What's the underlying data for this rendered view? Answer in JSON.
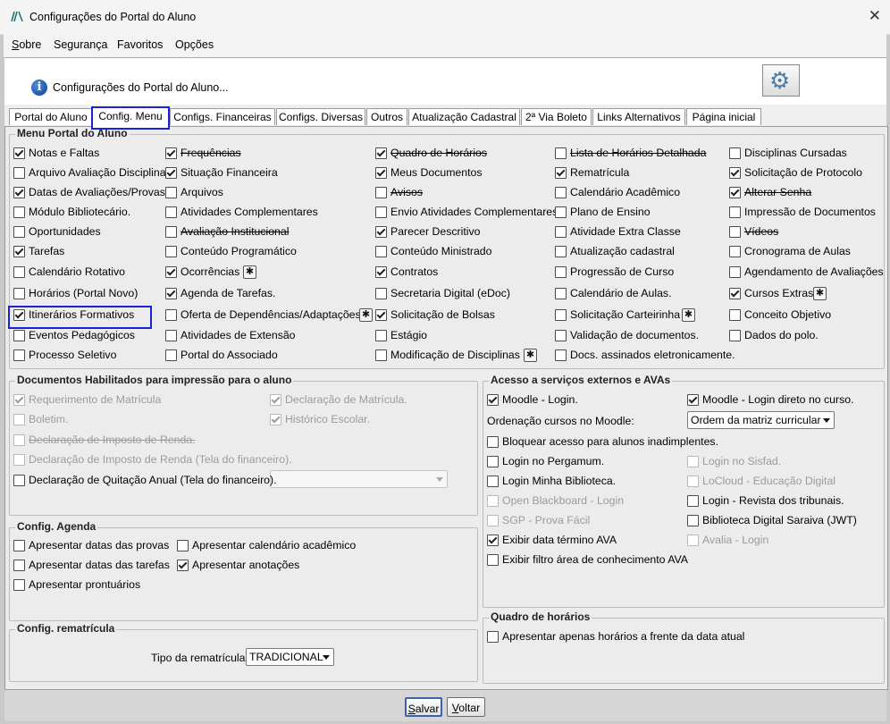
{
  "window": {
    "title": "Configurações do Portal do Aluno",
    "close_glyph": "✕"
  },
  "menu": [
    {
      "first": "S",
      "rest": "obre"
    },
    {
      "first": "",
      "rest": "Segurança"
    },
    {
      "first": "",
      "rest": "Favoritos"
    },
    {
      "first": "",
      "rest": "Opções"
    }
  ],
  "header": {
    "text": "Configurações do Portal do Aluno...",
    "info_glyph": "i",
    "gear_glyph": "⚙"
  },
  "tabs": [
    "Portal do Aluno",
    "Config. Menu",
    "Configs. Financeiras",
    "Configs. Diversas",
    "Outros",
    "Atualização Cadastral",
    "2ª Via Boleto",
    "Links Alternativos",
    "Página inicial"
  ],
  "active_tab": "Config. Menu",
  "menu_portal": {
    "title": "Menu Portal do Aluno",
    "items": [
      {
        "label": "Notas e Faltas",
        "checked": true
      },
      {
        "label": "Frequências",
        "checked": true,
        "strike": true
      },
      {
        "label": "Quadro de Horários",
        "checked": true,
        "strike": true
      },
      {
        "label": "Lista de Horários Detalhada",
        "checked": false,
        "strike": true
      },
      {
        "label": "Disciplinas Cursadas",
        "checked": false
      },
      {
        "label": "Arquivo Avaliação Disciplina",
        "checked": false
      },
      {
        "label": "Situação Financeira",
        "checked": true
      },
      {
        "label": "Meus Documentos",
        "checked": true
      },
      {
        "label": "Rematrícula",
        "checked": true
      },
      {
        "label": "Solicitação de Protocolo",
        "checked": true
      },
      {
        "label": "Datas de Avaliações/Provas",
        "checked": true
      },
      {
        "label": "Arquivos",
        "checked": false
      },
      {
        "label": "Avisos",
        "checked": false,
        "strike": true
      },
      {
        "label": "Calendário Acadêmico",
        "checked": false
      },
      {
        "label": "Alterar Senha",
        "checked": true,
        "strike": true
      },
      {
        "label": "Módulo Bibliotecário.",
        "checked": false
      },
      {
        "label": "Atividades Complementares",
        "checked": false
      },
      {
        "label": "Envio Atividades Complementares",
        "checked": false
      },
      {
        "label": "Plano de Ensino",
        "checked": false
      },
      {
        "label": "Impressão de Documentos",
        "checked": false
      },
      {
        "label": "Oportunidades",
        "checked": false
      },
      {
        "label": "Avaliação Institucional",
        "checked": false,
        "strike": true
      },
      {
        "label": "Parecer Descritivo",
        "checked": true
      },
      {
        "label": "Atividade Extra Classe",
        "checked": false
      },
      {
        "label": "Vídeos",
        "checked": false,
        "strike": true
      },
      {
        "label": "Tarefas",
        "checked": true
      },
      {
        "label": "Conteúdo Programático",
        "checked": false
      },
      {
        "label": "Conteúdo Ministrado",
        "checked": false
      },
      {
        "label": "Atualização cadastral",
        "checked": false
      },
      {
        "label": "Cronograma de Aulas",
        "checked": false
      },
      {
        "label": "Calendário Rotativo",
        "checked": false
      },
      {
        "label": "Ocorrências",
        "checked": true
      },
      {
        "label": "Contratos",
        "checked": true
      },
      {
        "label": "Progressão de Curso",
        "checked": false
      },
      {
        "label": "Agendamento de Avaliações",
        "checked": false
      },
      {
        "label": "Horários (Portal Novo)",
        "checked": false
      },
      {
        "label": "Agenda de Tarefas.",
        "checked": true
      },
      {
        "label": "Secretaria Digital (eDoc)",
        "checked": false
      },
      {
        "label": "Calendário de Aulas.",
        "checked": false
      },
      {
        "label": "Cursos Extras",
        "checked": true
      },
      {
        "label": "Itinerários Formativos",
        "checked": true
      },
      {
        "label": "Oferta de Dependências/Adaptações",
        "checked": false
      },
      {
        "label": "Solicitação de Bolsas",
        "checked": true
      },
      {
        "label": "Solicitação Carteirinha",
        "checked": false
      },
      {
        "label": "Conceito Objetivo",
        "checked": false
      },
      {
        "label": "Eventos Pedagógicos",
        "checked": false
      },
      {
        "label": "Atividades de Extensão",
        "checked": false
      },
      {
        "label": "Estágio",
        "checked": false
      },
      {
        "label": "Validação de documentos.",
        "checked": false
      },
      {
        "label": "Dados do polo.",
        "checked": false
      },
      {
        "label": "Processo Seletivo",
        "checked": false
      },
      {
        "label": "Portal do Associado",
        "checked": false
      },
      {
        "label": "Modificação de Disciplinas",
        "checked": false
      },
      {
        "label": "Docs. assinados eletronicamente.",
        "checked": false
      }
    ]
  },
  "docs": {
    "title": "Documentos Habilitados para impressão para o aluno",
    "items": [
      {
        "label": "Requerimento de Matrícula",
        "checked": true,
        "disabled": true
      },
      {
        "label": "Declaração de Matrícula.",
        "checked": true,
        "disabled": true
      },
      {
        "label": "Boletim.",
        "checked": false,
        "disabled": true
      },
      {
        "label": "Histórico Escolar.",
        "checked": true,
        "disabled": true
      },
      {
        "label": "Declaração de Imposto de Renda.",
        "checked": false,
        "disabled": true,
        "strike": true
      },
      {
        "label": "Declaração de Imposto de Renda (Tela do financeiro).",
        "checked": false,
        "disabled": true
      },
      {
        "label": "Declaração de Quitação Anual (Tela do financeiro).",
        "checked": false
      }
    ],
    "quitacao_select": ""
  },
  "agenda": {
    "title": "Config. Agenda",
    "items": [
      {
        "label": "Apresentar datas das provas",
        "checked": false
      },
      {
        "label": "Apresentar calendário acadêmico",
        "checked": false
      },
      {
        "label": "Apresentar datas das tarefas",
        "checked": false
      },
      {
        "label": "Apresentar anotações",
        "checked": true
      },
      {
        "label": "Apresentar prontuários",
        "checked": false
      }
    ]
  },
  "rematricula": {
    "title": "Config. rematrícula",
    "tipo_label": "Tipo da rematrícula:",
    "tipo_value": "TRADICIONAL"
  },
  "ava": {
    "title": "Acesso a serviços externos e AVAs",
    "ordenacao_label": "Ordenação cursos no Moodle:",
    "ordenacao_value": "Ordem da matriz curricular",
    "items": [
      {
        "label": "Moodle - Login.",
        "checked": true
      },
      {
        "label": "Moodle - Login direto no curso.",
        "checked": true
      },
      {
        "label": "Bloquear acesso para alunos inadimplentes.",
        "checked": false
      },
      {
        "label": "Login no Pergamum.",
        "checked": false
      },
      {
        "label": "Login no Sisfad.",
        "checked": false,
        "disabled": true
      },
      {
        "label": "Login Minha Biblioteca.",
        "checked": false
      },
      {
        "label": "LoCloud - Educação Digital",
        "checked": false,
        "disabled": true
      },
      {
        "label": "Open Blackboard - Login",
        "checked": false,
        "disabled": true
      },
      {
        "label": "Login - Revista dos tribunais.",
        "checked": false
      },
      {
        "label": "SGP - Prova Fácil",
        "checked": false,
        "disabled": true
      },
      {
        "label": "Biblioteca Digital Saraiva (JWT)",
        "checked": false
      },
      {
        "label": "Exibir data término AVA",
        "checked": true
      },
      {
        "label": "Avalia - Login",
        "checked": false,
        "disabled": true
      },
      {
        "label": "Exibir filtro área de conhecimento AVA",
        "checked": false
      }
    ]
  },
  "quadro": {
    "title": "Quadro de horários",
    "items": [
      {
        "label": "Apresentar apenas horários a frente da data atual",
        "checked": false
      }
    ]
  },
  "buttons": {
    "salvar_first": "S",
    "salvar_rest": "alvar",
    "voltar_first": "V",
    "voltar_rest": "oltar"
  }
}
